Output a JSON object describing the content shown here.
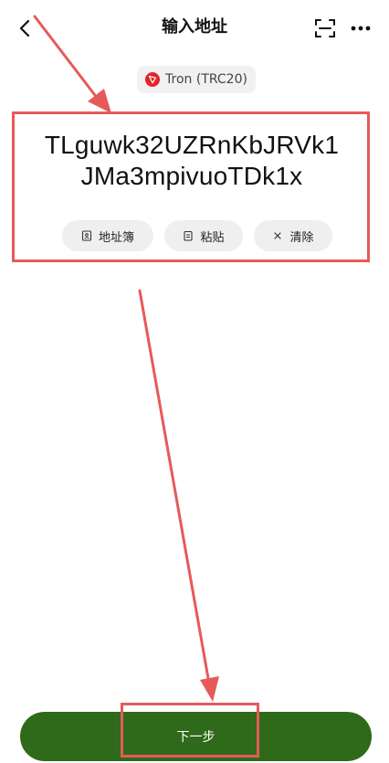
{
  "header": {
    "title": "输入地址",
    "back_icon": "chevron-left-icon",
    "scan_icon": "scan-icon",
    "more_icon": "more-horizontal-icon"
  },
  "network": {
    "label": "Tron (TRC20)",
    "icon": "tron-logo-icon",
    "icon_color": "#e3252b"
  },
  "address": {
    "line1": "TLguwk32UZRnKbJRVk1",
    "line2": "JMa3mpivuoTDk1x"
  },
  "actions": {
    "address_book_label": "地址簿",
    "paste_label": "粘贴",
    "clear_label": "清除"
  },
  "footer": {
    "next_label": "下一步",
    "button_color": "#2e6a1a"
  },
  "annotation_color": "#e65a5a"
}
